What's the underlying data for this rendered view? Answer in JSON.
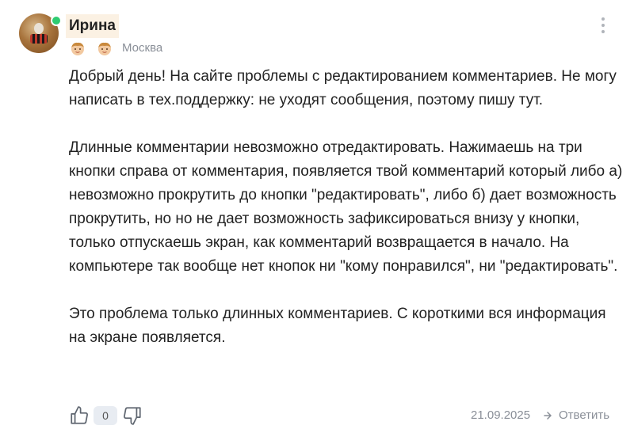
{
  "comment": {
    "author": "Ирина",
    "location": "Москва",
    "paragraphs": [
      "Добрый день! На сайте проблемы с редактированием комментариев. Не могу написать в тех.поддержку: не уходят сообщения, поэтому пишу тут.",
      "Длинные комментарии невозможно отредактировать. Нажимаешь на три кнопки справа от комментария, появляется твой комментарий который либо а) невозможно прокрутить до кнопки \"редактировать\", либо б) дает возможность прокрутить, но но не дает возможность зафиксироваться внизу у кнопки, только отпускаешь экран, как комментарий возвращается в начало. На компьютере так вообще нет кнопок ни \"кому понравился\", ни \"редактировать\".",
      "Это проблема только длинных комментариев. С короткими вся информация на экране появляется."
    ],
    "likes": "0",
    "date": "21.09.2025",
    "reply_label": "Ответить",
    "badges": [
      "child-avatar-icon",
      "child-avatar-icon"
    ],
    "icons": {
      "like": "thumbs-up-icon",
      "dislike": "thumbs-down-icon",
      "menu": "more-vertical-icon",
      "reply": "reply-arrow-icon"
    },
    "colors": {
      "online": "#2ecc71",
      "name_highlight": "#fbf1e3",
      "muted_text": "#8a8f98"
    }
  }
}
